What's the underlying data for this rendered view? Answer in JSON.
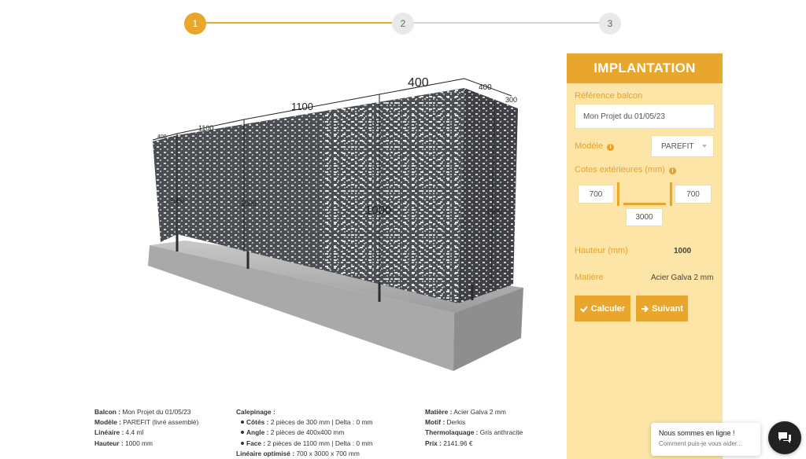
{
  "stepper": {
    "steps": [
      "1",
      "2",
      "3"
    ],
    "active": 1
  },
  "preview": {
    "dimensions": [
      "400",
      "1100",
      "1100",
      "400",
      "400",
      "300"
    ],
    "heights": [
      "1000",
      "1000",
      "1000",
      "1000"
    ],
    "alt": "3D balcony fence preview"
  },
  "panel": {
    "title": "IMPLANTATION",
    "reference_label": "Référence balcon",
    "reference_value": "Mon Projet du 01/05/23",
    "model_label": "Modèle",
    "model_value": "PAREFIT",
    "cotes_label": "Cotes extérieures (mm)",
    "cote_left": "700",
    "cote_right": "700",
    "cote_front": "3000",
    "height_label": "Hauteur (mm)",
    "height_value": "1000",
    "material_label": "Matière",
    "material_value": "Acier Galva 2 mm",
    "calc_button": "Calculer",
    "next_button": "Suivant"
  },
  "summary": {
    "balcon_label": "Balcon :",
    "balcon_value": " Mon Projet du 01/05/23",
    "modele_label": "Modèle :",
    "modele_value": " PAREFIT (livré assemblé)",
    "lineaire_label": "Linéaire :",
    "lineaire_value": " 4.4 ml",
    "hauteur_label": "Hauteur :",
    "hauteur_value": " 1000 mm",
    "calepinage_label": "Calepinage :",
    "cotes_label": "Côtés :",
    "cotes_value": " 2 pièces de 300 mm | Delta : 0 mm",
    "angle_label": "Angle :",
    "angle_value": " 2 pièces de 400x400 mm",
    "face_label": "Face :",
    "face_value": " 2 pièces de 1100 mm | Delta : 0 mm",
    "lineaire_opt_label": "Linéaire optimisé :",
    "lineaire_opt_value": " 700 x 3000 x 700 mm",
    "matiere_label": "Matière :",
    "matiere_value": " Acier Galva 2 mm",
    "motif_label": "Motif :",
    "motif_value": " Derkis",
    "thermo_label": "Thermolaquage :",
    "thermo_value": " Gris anthracite",
    "prix_label": "Prix :",
    "prix_value": " 2141.96 €"
  },
  "chat": {
    "title": "Nous sommes en ligne !",
    "subtitle": "Comment puis-je vous aider..."
  },
  "colors": {
    "accent": "#e8a72c",
    "panel_bg": "#fce5a6",
    "panel_label": "#eaa12b"
  }
}
